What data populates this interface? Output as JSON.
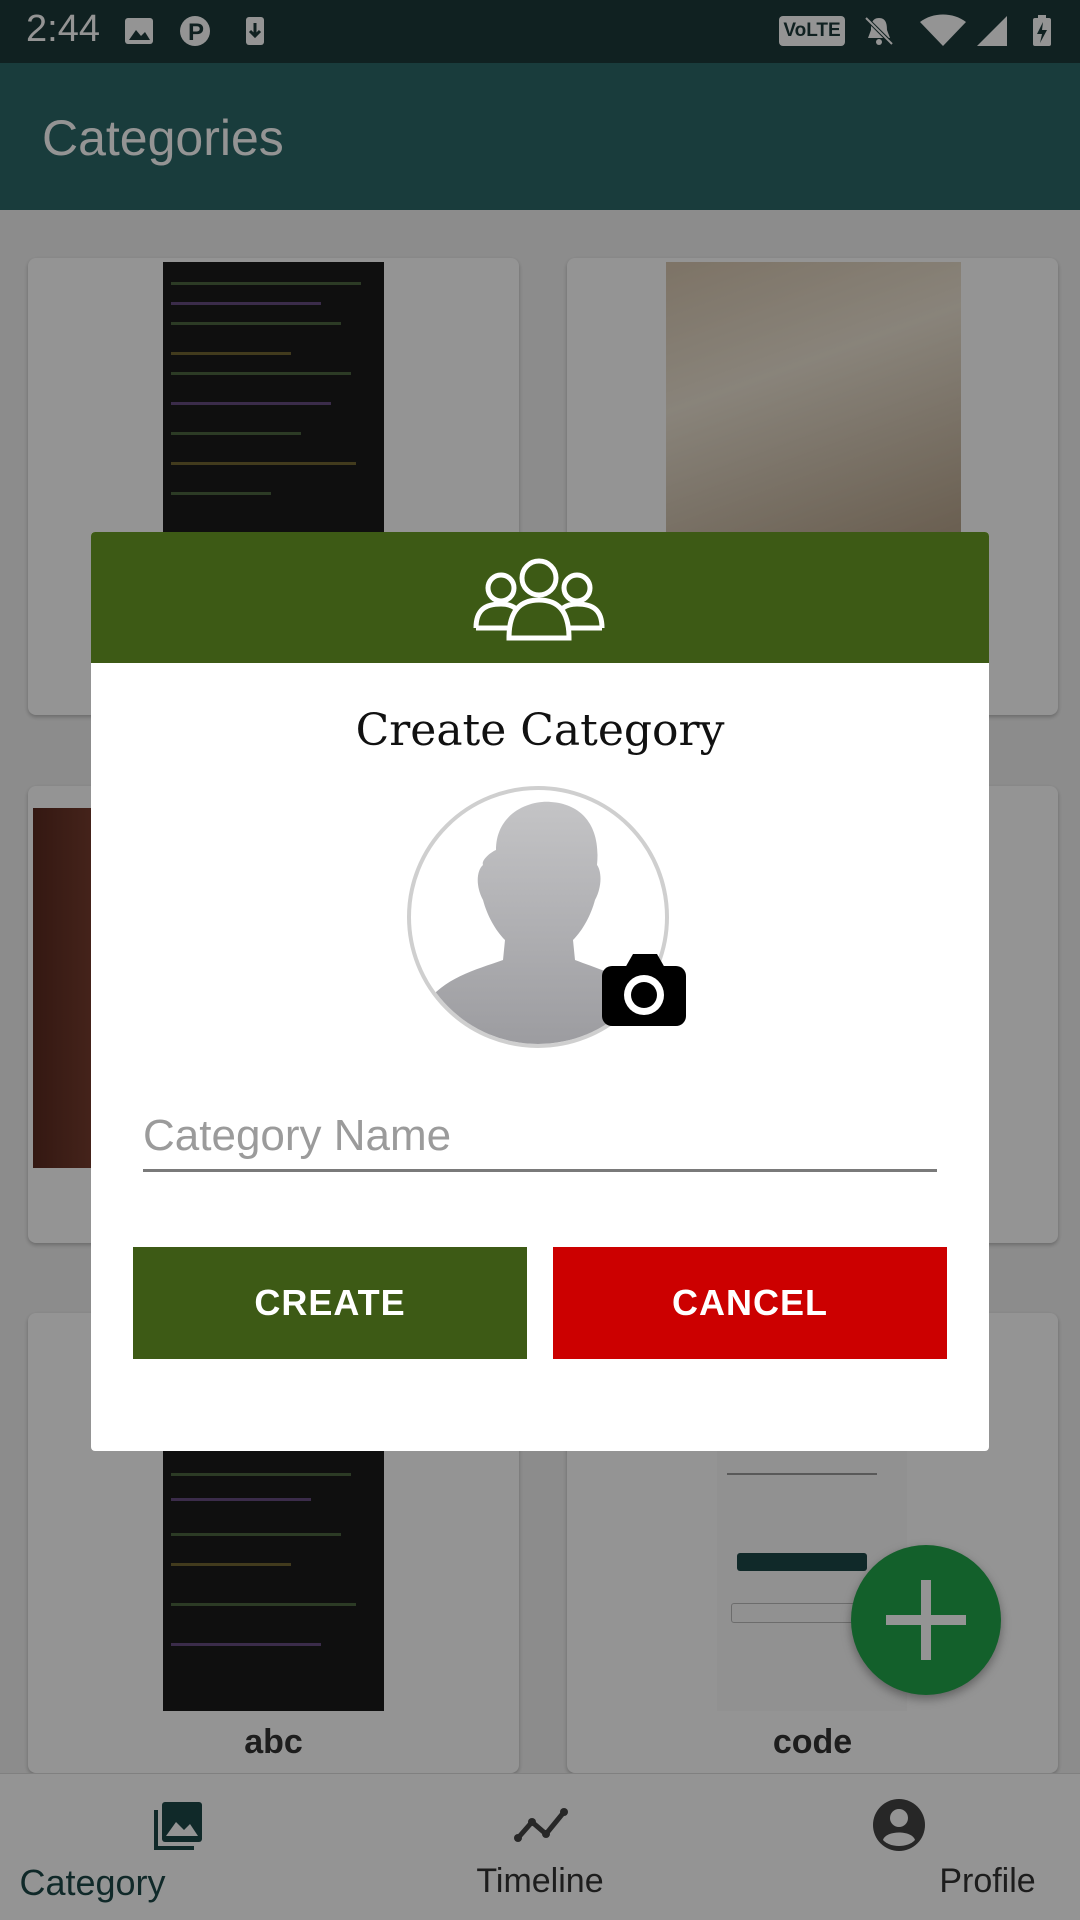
{
  "status_bar": {
    "time": "2:44",
    "network_badge": "VoLTE",
    "icons": [
      "image-icon",
      "parking-icon",
      "download-icon",
      "mute-icon",
      "wifi-icon",
      "signal-icon",
      "battery-icon"
    ]
  },
  "app_bar": {
    "title": "Categories"
  },
  "grid": {
    "cards": [
      {
        "label": "abc"
      },
      {
        "label": "code"
      }
    ]
  },
  "dialog": {
    "header_icon": "group-icon",
    "title": "Create Category",
    "avatar_icon": "person-placeholder-icon",
    "camera_icon": "camera-icon",
    "name_input": {
      "placeholder": "Category Name",
      "value": ""
    },
    "create_label": "CREATE",
    "cancel_label": "CANCEL"
  },
  "fab": {
    "icon": "plus-icon"
  },
  "bottom_nav": {
    "items": [
      {
        "label": "Category",
        "icon": "gallery-icon",
        "active": true
      },
      {
        "label": "Timeline",
        "icon": "timeline-icon",
        "active": false
      },
      {
        "label": "Profile",
        "icon": "account-icon",
        "active": false
      }
    ]
  },
  "colors": {
    "status_bar": "#1c3a3a",
    "app_bar": "#2b6868",
    "dialog_header": "#3d5a15",
    "create_button": "#3d5a15",
    "cancel_button": "#cc0000",
    "fab": "#21a64a"
  }
}
